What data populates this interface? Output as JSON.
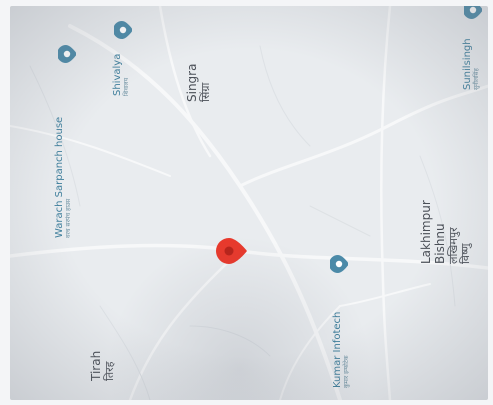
{
  "colors": {
    "map_background": "#e9ecef",
    "road": "#ffffff",
    "place_text": "#4a4f57",
    "poi_text": "#3f7f9c",
    "poi_pin": "#4b8aa8",
    "current_location_pin": "#e8392c"
  },
  "places": {
    "singra": {
      "name": "Singra",
      "local": "सिंग्रा"
    },
    "tirah": {
      "name": "Tirah",
      "local": "तिरह"
    },
    "lakhimpur": {
      "line1": "Lakhimpur",
      "line2": "Bishnu",
      "local1": "लखिमपुर",
      "local2": "विष्णु"
    }
  },
  "pois": {
    "warach": {
      "name": "Warach Sarpanch house",
      "local": "वरच सरपंच हाउस",
      "icon": "map-pin-icon"
    },
    "shivalya": {
      "name": "Shivalya",
      "local": "शिवालय",
      "icon": "map-pin-icon"
    },
    "kumar": {
      "name": "Kumar Infotech",
      "local": "कुमार इन्फोटेक",
      "icon": "map-pin-icon"
    },
    "sunilsingh": {
      "name": "Sunilsingh",
      "local": "सुनीलसिंह",
      "icon": "map-pin-icon"
    }
  },
  "current_location": {
    "icon": "location-marker-icon"
  }
}
